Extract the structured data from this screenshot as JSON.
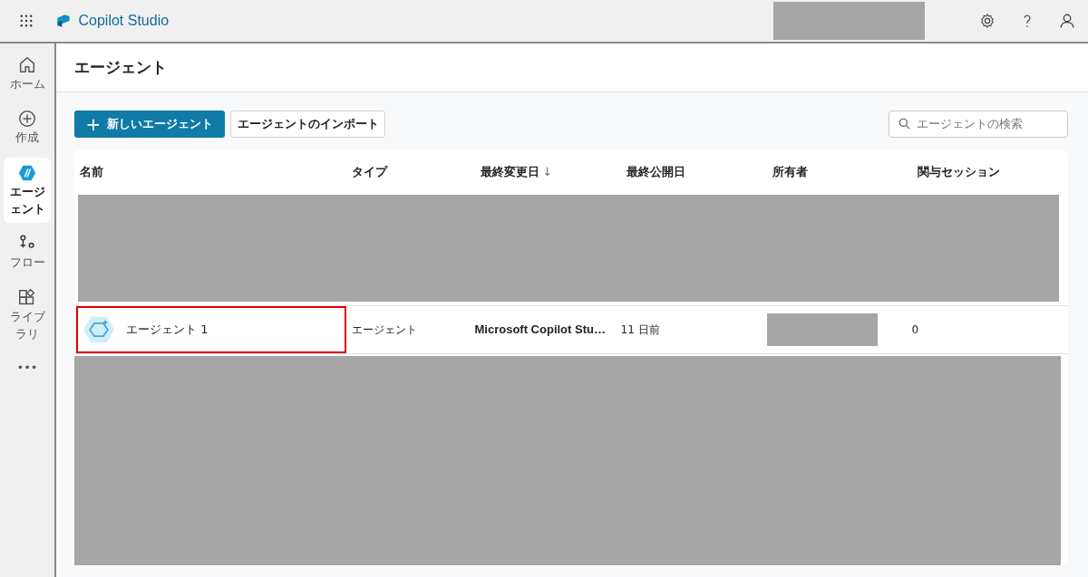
{
  "app": {
    "title": "Copilot Studio"
  },
  "rail": [
    {
      "label": "ホーム",
      "selected": false
    },
    {
      "label": "作成",
      "selected": false
    },
    {
      "label": "エージェント",
      "selected": true
    },
    {
      "label": "フロー",
      "selected": false
    },
    {
      "label": "ライブラリ",
      "selected": false
    },
    {
      "label": "•••",
      "selected": false
    }
  ],
  "page_title": "エージェント",
  "toolbar": {
    "primary": {
      "icon": "+",
      "label": "新しいエージェント"
    },
    "secondary": "エージェントのインポート",
    "search": {
      "placeholder": "エージェントの検索"
    }
  },
  "table": {
    "columns": [
      {
        "label": "名前"
      },
      {
        "label": "タイプ"
      },
      {
        "label": "最終変更日",
        "sort": "↓"
      },
      {
        "label": "最終公開日"
      },
      {
        "label": "所有者"
      },
      {
        "label": "関与セッション"
      }
    ],
    "rows": [
      {
        "kind": "redacted"
      },
      {
        "kind": "agent",
        "highlighted": true,
        "name": "エージェント 1",
        "type": "エージェント",
        "modified": "Microsoft Copilot Stu…",
        "published": "11 日前",
        "sessions": "0"
      },
      {
        "kind": "redacted"
      }
    ]
  }
}
